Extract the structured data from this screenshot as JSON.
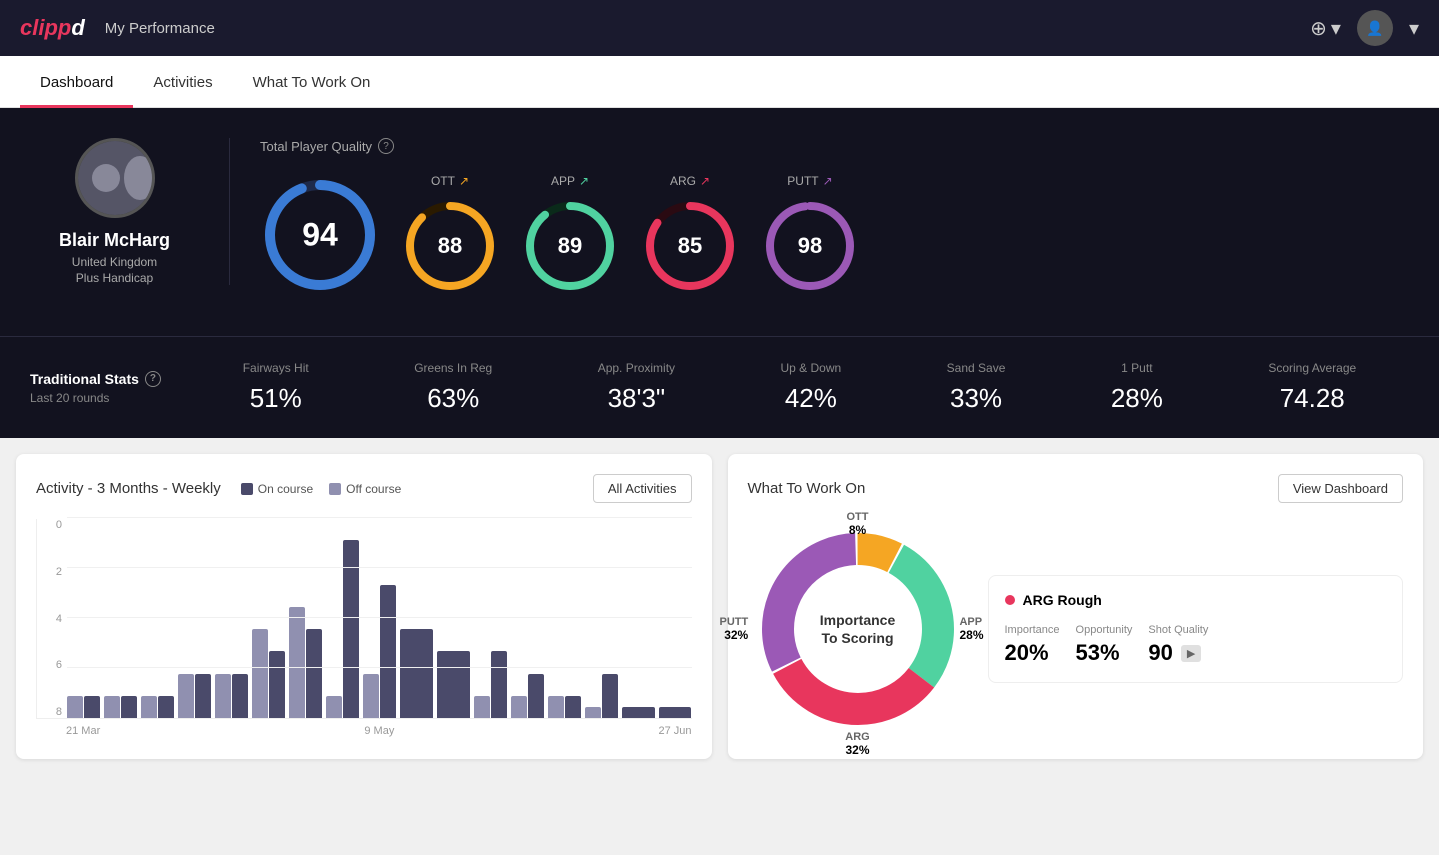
{
  "app": {
    "logo": "clippd",
    "header_title": "My Performance"
  },
  "nav": {
    "tabs": [
      {
        "id": "dashboard",
        "label": "Dashboard",
        "active": true
      },
      {
        "id": "activities",
        "label": "Activities",
        "active": false
      },
      {
        "id": "what-to-work-on",
        "label": "What To Work On",
        "active": false
      }
    ]
  },
  "player": {
    "name": "Blair McHarg",
    "country": "United Kingdom",
    "handicap": "Plus Handicap",
    "avatar_initial": "👤"
  },
  "quality": {
    "title": "Total Player Quality",
    "scores": [
      {
        "id": "total",
        "value": "94",
        "label": "",
        "color": "#3a7bd5",
        "large": true
      },
      {
        "id": "ott",
        "value": "88",
        "label": "OTT",
        "color": "#f5a623"
      },
      {
        "id": "app",
        "value": "89",
        "label": "APP",
        "color": "#50d2a0"
      },
      {
        "id": "arg",
        "value": "85",
        "label": "ARG",
        "color": "#e8365d"
      },
      {
        "id": "putt",
        "value": "98",
        "label": "PUTT",
        "color": "#9b59b6"
      }
    ]
  },
  "traditional_stats": {
    "title": "Traditional Stats",
    "info": "?",
    "subtitle": "Last 20 rounds",
    "items": [
      {
        "label": "Fairways Hit",
        "value": "51%"
      },
      {
        "label": "Greens In Reg",
        "value": "63%"
      },
      {
        "label": "App. Proximity",
        "value": "38'3\""
      },
      {
        "label": "Up & Down",
        "value": "42%"
      },
      {
        "label": "Sand Save",
        "value": "33%"
      },
      {
        "label": "1 Putt",
        "value": "28%"
      },
      {
        "label": "Scoring Average",
        "value": "74.28"
      }
    ]
  },
  "activity_chart": {
    "title": "Activity - 3 Months - Weekly",
    "legend": {
      "on_course": "On course",
      "off_course": "Off course"
    },
    "all_activities_btn": "All Activities",
    "y_labels": [
      "0",
      "2",
      "4",
      "6",
      "8"
    ],
    "x_labels": [
      "21 Mar",
      "9 May",
      "27 Jun"
    ],
    "bars": [
      {
        "on": 1,
        "off": 1
      },
      {
        "on": 1,
        "off": 1
      },
      {
        "on": 1,
        "off": 1
      },
      {
        "on": 2,
        "off": 2
      },
      {
        "on": 2,
        "off": 2
      },
      {
        "on": 3,
        "off": 4
      },
      {
        "on": 4,
        "off": 5
      },
      {
        "on": 8,
        "off": 1
      },
      {
        "on": 6,
        "off": 2
      },
      {
        "on": 4,
        "off": 0
      },
      {
        "on": 3,
        "off": 0
      },
      {
        "on": 3,
        "off": 1
      },
      {
        "on": 2,
        "off": 1
      },
      {
        "on": 1,
        "off": 1
      },
      {
        "on": 2,
        "off": 0.5
      },
      {
        "on": 0.5,
        "off": 0
      },
      {
        "on": 0.5,
        "off": 0
      }
    ]
  },
  "what_to_work_on": {
    "title": "What To Work On",
    "view_dashboard_btn": "View Dashboard",
    "center_text": "Importance\nTo Scoring",
    "segments": [
      {
        "label": "OTT",
        "percent": "8%",
        "color": "#f5a623"
      },
      {
        "label": "APP",
        "percent": "28%",
        "color": "#50d2a0"
      },
      {
        "label": "ARG",
        "percent": "32%",
        "color": "#e8365d"
      },
      {
        "label": "PUTT",
        "percent": "32%",
        "color": "#9b59b6"
      }
    ],
    "detail": {
      "title": "ARG Rough",
      "dot_color": "#e8365d",
      "stats": [
        {
          "label": "Importance",
          "value": "20%"
        },
        {
          "label": "Opportunity",
          "value": "53%"
        },
        {
          "label": "Shot Quality",
          "value": "90"
        }
      ]
    }
  },
  "icons": {
    "plus_circle": "⊕",
    "chevron_down": "▾",
    "info": "?",
    "arrow_up_right": "↗"
  }
}
